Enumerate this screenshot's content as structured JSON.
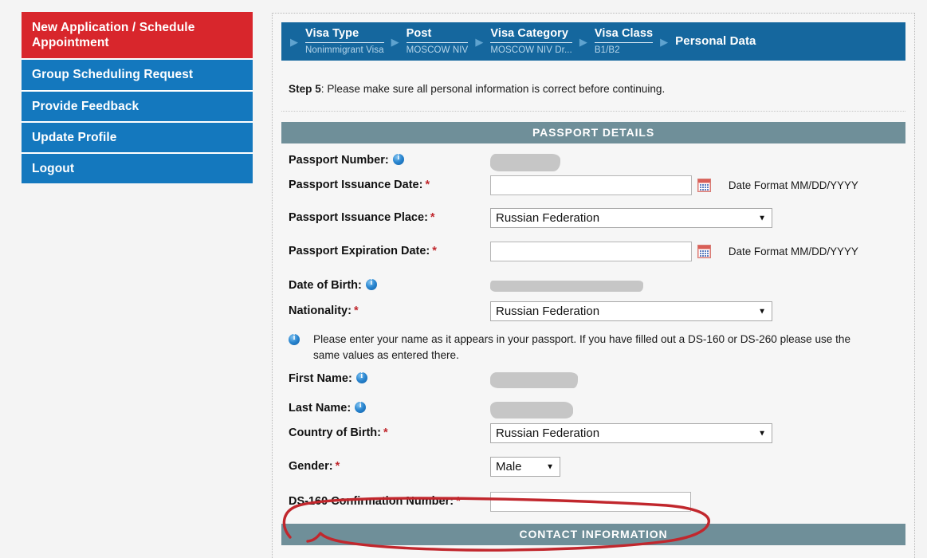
{
  "sidebar": {
    "items": [
      {
        "label": "New Application / Schedule Appointment",
        "style": "red"
      },
      {
        "label": "Group Scheduling Request",
        "style": "blue"
      },
      {
        "label": "Provide Feedback",
        "style": "blue"
      },
      {
        "label": "Update Profile",
        "style": "blue"
      },
      {
        "label": "Logout",
        "style": "blue"
      }
    ]
  },
  "breadcrumb": {
    "steps": [
      {
        "title": "Visa Type",
        "sub": "Nonimmigrant Visa"
      },
      {
        "title": "Post",
        "sub": "MOSCOW NIV"
      },
      {
        "title": "Visa Category",
        "sub": "MOSCOW NIV Dr..."
      },
      {
        "title": "Visa Class",
        "sub": "B1/B2"
      },
      {
        "title": "Personal Data",
        "sub": ""
      }
    ],
    "arrow_glyph": "▶"
  },
  "step": {
    "label": "Step 5",
    "text": ": Please make sure all personal information is correct before continuing."
  },
  "sections": {
    "passport_details_title": "PASSPORT DETAILS",
    "contact_information_title": "CONTACT INFORMATION"
  },
  "fields": {
    "passport_number": {
      "label": "Passport Number:",
      "value": "",
      "redacted": true
    },
    "passport_issuance_date": {
      "label": "Passport Issuance Date:",
      "required": true,
      "value": "",
      "hint": "Date Format MM/DD/YYYY"
    },
    "passport_issuance_place": {
      "label": "Passport Issuance Place:",
      "required": true,
      "value": "Russian Federation"
    },
    "passport_expiration_date": {
      "label": "Passport Expiration Date:",
      "required": true,
      "value": "",
      "hint": "Date Format MM/DD/YYYY"
    },
    "date_of_birth": {
      "label": "Date of Birth:",
      "value": "",
      "redacted": true
    },
    "nationality": {
      "label": "Nationality:",
      "required": true,
      "value": "Russian Federation"
    },
    "first_name": {
      "label": "First Name:",
      "value": "",
      "redacted": true
    },
    "last_name": {
      "label": "Last Name:",
      "value": "",
      "redacted": true
    },
    "country_of_birth": {
      "label": "Country of Birth:",
      "required": true,
      "value": "Russian Federation"
    },
    "gender": {
      "label": "Gender:",
      "required": true,
      "value": "Male"
    },
    "ds160_confirmation": {
      "label": "DS-160 Confirmation Number:",
      "required": true,
      "value": ""
    }
  },
  "notice": {
    "text": "Please enter your name as it appears in your passport. If you have filled out a DS-160 or DS-260 please use the same values as entered there."
  },
  "markers": {
    "required_glyph": "*",
    "caret_glyph": "▼",
    "info_icon": "info-icon",
    "calendar_icon": "calendar-icon"
  },
  "colors": {
    "nav_red": "#d8262c",
    "nav_blue": "#1478be",
    "breadcrumb_blue": "#15679e",
    "section_header_teal": "#6f8f99",
    "required_red": "#c0272d",
    "annotation_red": "#c1272d",
    "redaction_gray": "#c6c6c6"
  }
}
